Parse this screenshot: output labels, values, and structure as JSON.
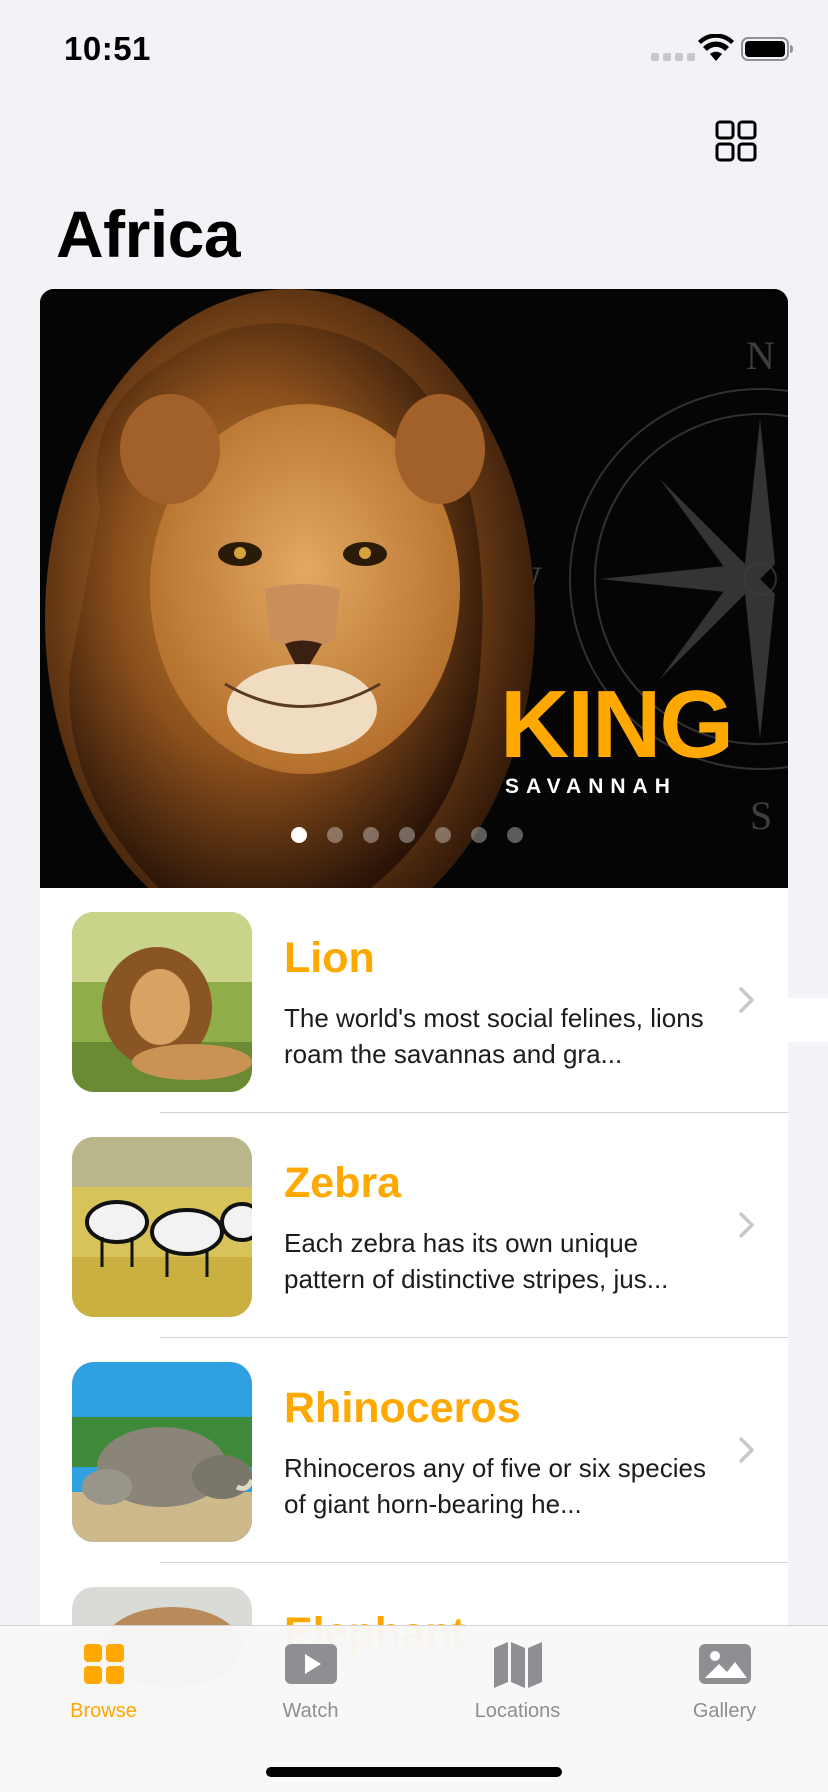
{
  "status_bar": {
    "time": "10:51"
  },
  "header": {
    "title": "Africa"
  },
  "hero": {
    "headline": "KING",
    "subheadline": "SAVANNAH",
    "compass_letters": [
      "N",
      "W",
      "S"
    ],
    "page_count": 7,
    "active_page": 0
  },
  "animals": [
    {
      "name": "Lion",
      "description": "The world's most social felines, lions roam the savannas and gra..."
    },
    {
      "name": "Zebra",
      "description": "Each zebra has its own unique pattern of distinctive stripes, jus..."
    },
    {
      "name": "Rhinoceros",
      "description": "Rhinoceros any of five or six species of giant horn-bearing he..."
    },
    {
      "name": "Elephant",
      "description": ""
    }
  ],
  "tabs": [
    {
      "label": "Browse",
      "icon": "grid-square-icon"
    },
    {
      "label": "Watch",
      "icon": "play-rectangle-icon"
    },
    {
      "label": "Locations",
      "icon": "map-icon"
    },
    {
      "label": "Gallery",
      "icon": "photo-icon"
    }
  ],
  "colors": {
    "accent": "#ffa800",
    "background": "#f2f2f7",
    "inactive": "#8e8e93"
  }
}
